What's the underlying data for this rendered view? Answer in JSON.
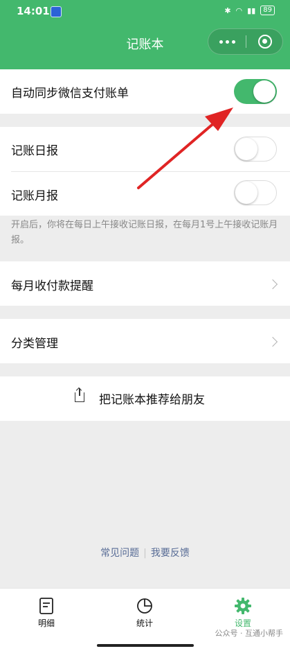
{
  "status_bar": {
    "time": "14:01",
    "battery": "89"
  },
  "header": {
    "title": "记账本"
  },
  "settings": {
    "auto_sync": {
      "label": "自动同步微信支付账单",
      "enabled": true
    },
    "daily_report": {
      "label": "记账日报",
      "enabled": false
    },
    "monthly_report": {
      "label": "记账月报",
      "enabled": false
    },
    "report_note": "开启后，你将在每日上午接收记账日报，在每月1号上午接收记账月报。",
    "payment_reminder": {
      "label": "每月收付款提醒"
    },
    "category_manage": {
      "label": "分类管理"
    },
    "share": {
      "label": "把记账本推荐给朋友"
    }
  },
  "footer_links": {
    "faq": "常见问题",
    "feedback": "我要反馈"
  },
  "tabbar": [
    {
      "label": "明细",
      "icon": "list-icon",
      "active": false
    },
    {
      "label": "统计",
      "icon": "pie-chart-icon",
      "active": false
    },
    {
      "label": "设置",
      "icon": "gear-icon",
      "active": true
    }
  ],
  "watermark": "公众号 · 互通小帮手",
  "colors": {
    "brand": "#43b86d",
    "annotation_arrow": "#e02424",
    "link": "#576b95"
  }
}
